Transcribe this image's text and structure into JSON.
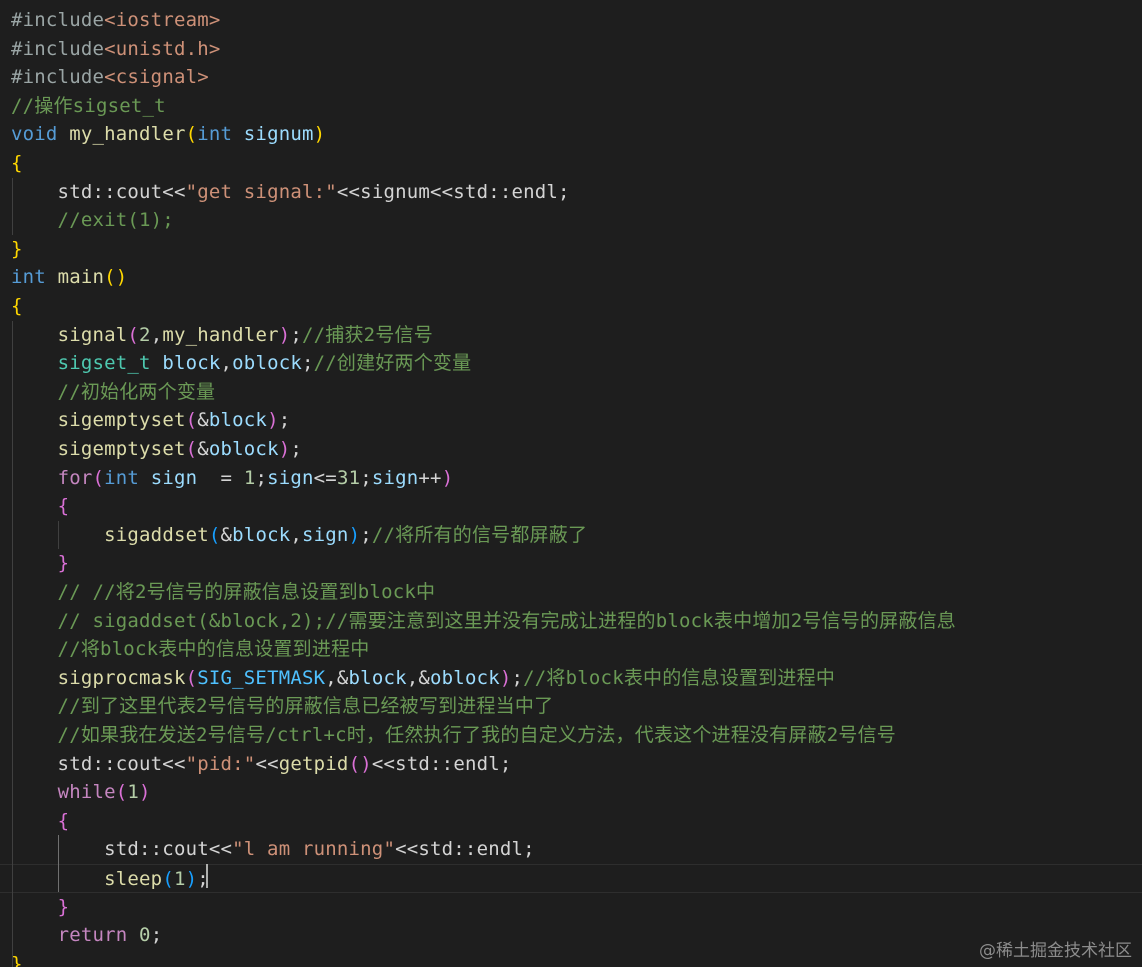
{
  "editor": {
    "lines": [
      {
        "tokens": [
          {
            "t": "#include",
            "c": "gr"
          },
          {
            "t": "<iostream>",
            "c": "s"
          }
        ]
      },
      {
        "tokens": [
          {
            "t": "#include",
            "c": "gr"
          },
          {
            "t": "<unistd.h>",
            "c": "s"
          }
        ]
      },
      {
        "tokens": [
          {
            "t": "#include",
            "c": "gr"
          },
          {
            "t": "<csignal>",
            "c": "s"
          }
        ]
      },
      {
        "tokens": [
          {
            "t": "//操作sigset_t",
            "c": "cm"
          }
        ]
      },
      {
        "tokens": [
          {
            "t": "void",
            "c": "k"
          },
          {
            "t": " ",
            "c": "p"
          },
          {
            "t": "my_handler",
            "c": "f"
          },
          {
            "t": "(",
            "c": "b1"
          },
          {
            "t": "int",
            "c": "k"
          },
          {
            "t": " signum",
            "c": "v"
          },
          {
            "t": ")",
            "c": "b1"
          }
        ]
      },
      {
        "tokens": [
          {
            "t": "{",
            "c": "b1"
          }
        ]
      },
      {
        "tokens": [
          {
            "t": "    std::cout<<",
            "c": "p"
          },
          {
            "t": "\"get signal:\"",
            "c": "s"
          },
          {
            "t": "<<signum<<std::endl;",
            "c": "p"
          }
        ]
      },
      {
        "tokens": [
          {
            "t": "    //exit(1);",
            "c": "cm"
          }
        ]
      },
      {
        "tokens": [
          {
            "t": "}",
            "c": "b1"
          }
        ]
      },
      {
        "tokens": [
          {
            "t": "int",
            "c": "k"
          },
          {
            "t": " ",
            "c": "p"
          },
          {
            "t": "main",
            "c": "f"
          },
          {
            "t": "()",
            "c": "b1"
          }
        ]
      },
      {
        "tokens": [
          {
            "t": "{",
            "c": "b1"
          }
        ]
      },
      {
        "tokens": [
          {
            "t": "    ",
            "c": "p"
          },
          {
            "t": "signal",
            "c": "f"
          },
          {
            "t": "(",
            "c": "b2"
          },
          {
            "t": "2",
            "c": "n"
          },
          {
            "t": ",",
            "c": "p"
          },
          {
            "t": "my_handler",
            "c": "f"
          },
          {
            "t": ")",
            "c": "b2"
          },
          {
            "t": ";",
            "c": "p"
          },
          {
            "t": "//捕获2号信号",
            "c": "cm"
          }
        ]
      },
      {
        "tokens": [
          {
            "t": "    ",
            "c": "p"
          },
          {
            "t": "sigset_t",
            "c": "t"
          },
          {
            "t": " ",
            "c": "p"
          },
          {
            "t": "block",
            "c": "v"
          },
          {
            "t": ",",
            "c": "p"
          },
          {
            "t": "oblock",
            "c": "v"
          },
          {
            "t": ";",
            "c": "p"
          },
          {
            "t": "//创建好两个变量",
            "c": "cm"
          }
        ]
      },
      {
        "tokens": [
          {
            "t": "    //初始化两个变量",
            "c": "cm"
          }
        ]
      },
      {
        "tokens": [
          {
            "t": "    ",
            "c": "p"
          },
          {
            "t": "sigemptyset",
            "c": "f"
          },
          {
            "t": "(",
            "c": "b2"
          },
          {
            "t": "&",
            "c": "p"
          },
          {
            "t": "block",
            "c": "v"
          },
          {
            "t": ")",
            "c": "b2"
          },
          {
            "t": ";",
            "c": "p"
          }
        ]
      },
      {
        "tokens": [
          {
            "t": "    ",
            "c": "p"
          },
          {
            "t": "sigemptyset",
            "c": "f"
          },
          {
            "t": "(",
            "c": "b2"
          },
          {
            "t": "&",
            "c": "p"
          },
          {
            "t": "oblock",
            "c": "v"
          },
          {
            "t": ")",
            "c": "b2"
          },
          {
            "t": ";",
            "c": "p"
          }
        ]
      },
      {
        "tokens": [
          {
            "t": "    ",
            "c": "p"
          },
          {
            "t": "for",
            "c": "c"
          },
          {
            "t": "(",
            "c": "b2"
          },
          {
            "t": "int",
            "c": "k"
          },
          {
            "t": " ",
            "c": "p"
          },
          {
            "t": "sign",
            "c": "v"
          },
          {
            "t": "  = ",
            "c": "p"
          },
          {
            "t": "1",
            "c": "n"
          },
          {
            "t": ";",
            "c": "p"
          },
          {
            "t": "sign",
            "c": "v"
          },
          {
            "t": "<=",
            "c": "p"
          },
          {
            "t": "31",
            "c": "n"
          },
          {
            "t": ";",
            "c": "p"
          },
          {
            "t": "sign",
            "c": "v"
          },
          {
            "t": "++",
            "c": "p"
          },
          {
            "t": ")",
            "c": "b2"
          }
        ]
      },
      {
        "tokens": [
          {
            "t": "    ",
            "c": "p"
          },
          {
            "t": "{",
            "c": "b2"
          }
        ]
      },
      {
        "tokens": [
          {
            "t": "        ",
            "c": "p"
          },
          {
            "t": "sigaddset",
            "c": "f"
          },
          {
            "t": "(",
            "c": "b3"
          },
          {
            "t": "&",
            "c": "p"
          },
          {
            "t": "block",
            "c": "v"
          },
          {
            "t": ",",
            "c": "p"
          },
          {
            "t": "sign",
            "c": "v"
          },
          {
            "t": ")",
            "c": "b3"
          },
          {
            "t": ";",
            "c": "p"
          },
          {
            "t": "//将所有的信号都屏蔽了",
            "c": "cm"
          }
        ]
      },
      {
        "tokens": [
          {
            "t": "    ",
            "c": "p"
          },
          {
            "t": "}",
            "c": "b2"
          }
        ]
      },
      {
        "tokens": [
          {
            "t": "    // //将2号信号的屏蔽信息设置到block中",
            "c": "cm"
          }
        ]
      },
      {
        "tokens": [
          {
            "t": "    // sigaddset(&block,2);//需要注意到这里并没有完成让进程的block表中增加2号信号的屏蔽信息",
            "c": "cm"
          }
        ]
      },
      {
        "tokens": [
          {
            "t": "    //将block表中的信息设置到进程中",
            "c": "cm"
          }
        ]
      },
      {
        "tokens": [
          {
            "t": "    ",
            "c": "p"
          },
          {
            "t": "sigprocmask",
            "c": "f"
          },
          {
            "t": "(",
            "c": "b2"
          },
          {
            "t": "SIG_SETMASK",
            "c": "m"
          },
          {
            "t": ",",
            "c": "p"
          },
          {
            "t": "&",
            "c": "p"
          },
          {
            "t": "block",
            "c": "v"
          },
          {
            "t": ",",
            "c": "p"
          },
          {
            "t": "&",
            "c": "p"
          },
          {
            "t": "oblock",
            "c": "v"
          },
          {
            "t": ")",
            "c": "b2"
          },
          {
            "t": ";",
            "c": "p"
          },
          {
            "t": "//将block表中的信息设置到进程中",
            "c": "cm"
          }
        ]
      },
      {
        "tokens": [
          {
            "t": "    //到了这里代表2号信号的屏蔽信息已经被写到进程当中了",
            "c": "cm"
          }
        ]
      },
      {
        "tokens": [
          {
            "t": "    //如果我在发送2号信号/ctrl+c时，任然执行了我的自定义方法，代表这个进程没有屏蔽2号信号",
            "c": "cm"
          }
        ]
      },
      {
        "tokens": [
          {
            "t": "    std::cout<<",
            "c": "p"
          },
          {
            "t": "\"pid:\"",
            "c": "s"
          },
          {
            "t": "<<",
            "c": "p"
          },
          {
            "t": "getpid",
            "c": "f"
          },
          {
            "t": "()",
            "c": "b2"
          },
          {
            "t": "<<std::endl;",
            "c": "p"
          }
        ]
      },
      {
        "tokens": [
          {
            "t": "    ",
            "c": "p"
          },
          {
            "t": "while",
            "c": "c"
          },
          {
            "t": "(",
            "c": "b2"
          },
          {
            "t": "1",
            "c": "n"
          },
          {
            "t": ")",
            "c": "b2"
          }
        ]
      },
      {
        "tokens": [
          {
            "t": "    ",
            "c": "p"
          },
          {
            "t": "{",
            "c": "b2"
          }
        ]
      },
      {
        "tokens": [
          {
            "t": "        std::cout<<",
            "c": "p"
          },
          {
            "t": "\"l am running\"",
            "c": "s"
          },
          {
            "t": "<<std::endl;",
            "c": "p"
          }
        ]
      },
      {
        "tokens": [
          {
            "t": "        ",
            "c": "p"
          },
          {
            "t": "sleep",
            "c": "f"
          },
          {
            "t": "(",
            "c": "b3"
          },
          {
            "t": "1",
            "c": "n"
          },
          {
            "t": ")",
            "c": "b3"
          },
          {
            "t": ";",
            "c": "p"
          }
        ]
      },
      {
        "tokens": [
          {
            "t": "    ",
            "c": "p"
          },
          {
            "t": "}",
            "c": "b2"
          }
        ]
      },
      {
        "tokens": [
          {
            "t": "    ",
            "c": "p"
          },
          {
            "t": "return",
            "c": "c"
          },
          {
            "t": " ",
            "c": "p"
          },
          {
            "t": "0",
            "c": "n"
          },
          {
            "t": ";",
            "c": "p"
          }
        ]
      },
      {
        "tokens": [
          {
            "t": "}",
            "c": "b1"
          }
        ]
      }
    ],
    "current_line": 30
  },
  "watermark": "@稀土掘金技术社区",
  "colors": {
    "background": "#1e1e1e",
    "keyword": "#569cd6",
    "control": "#c586c0",
    "function": "#dcdcaa",
    "variable": "#9cdcfe",
    "string": "#ce9178",
    "number": "#b5cea8",
    "comment": "#6a9955",
    "type": "#4ec9b0"
  }
}
